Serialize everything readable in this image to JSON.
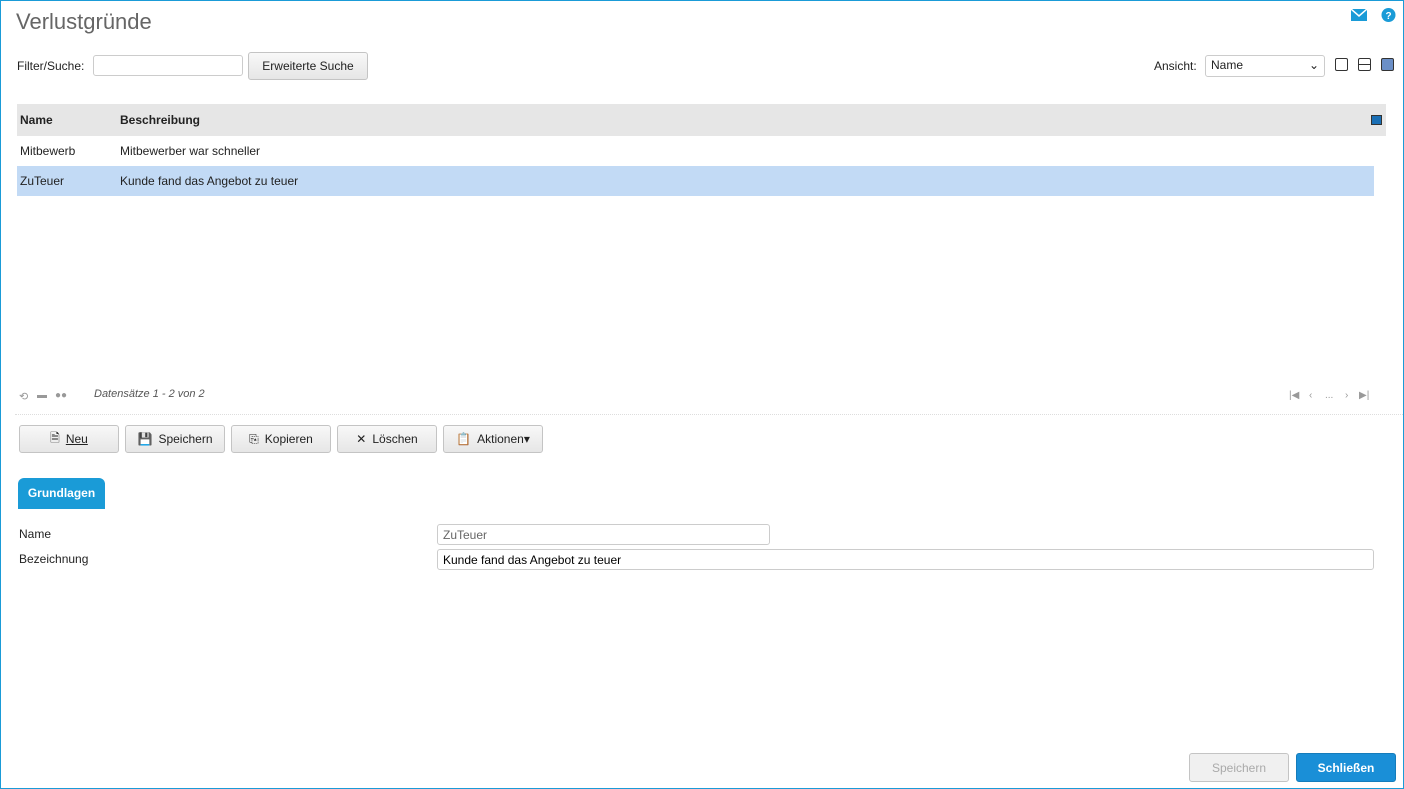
{
  "title": "Verlustgründe",
  "filter": {
    "label": "Filter/Suche:",
    "value": "",
    "advanced_button": "Erweiterte Suche"
  },
  "view": {
    "label": "Ansicht:",
    "selected": "Name"
  },
  "grid": {
    "columns": [
      "Name",
      "Beschreibung"
    ],
    "rows": [
      {
        "name": "Mitbewerb",
        "description": "Mitbewerber war schneller"
      },
      {
        "name": "ZuTeuer",
        "description": "Kunde fand das Angebot zu teuer"
      }
    ],
    "records": "Datensätze 1 - 2 von 2",
    "pager_ellipsis": "..."
  },
  "toolbar": {
    "new": "Neu",
    "save": "Speichern",
    "copy": "Kopieren",
    "delete": "Löschen",
    "actions": "Aktionen"
  },
  "tabs": [
    {
      "label": "Grundlagen"
    }
  ],
  "form": {
    "name_label": "Name",
    "name_value": "ZuTeuer",
    "desc_label": "Bezeichnung",
    "desc_value": "Kunde fand das Angebot zu teuer"
  },
  "footer": {
    "save": "Speichern",
    "close": "Schließen"
  },
  "colors": {
    "accent": "#1a9bd7",
    "selected_row": "#c2daf5"
  }
}
